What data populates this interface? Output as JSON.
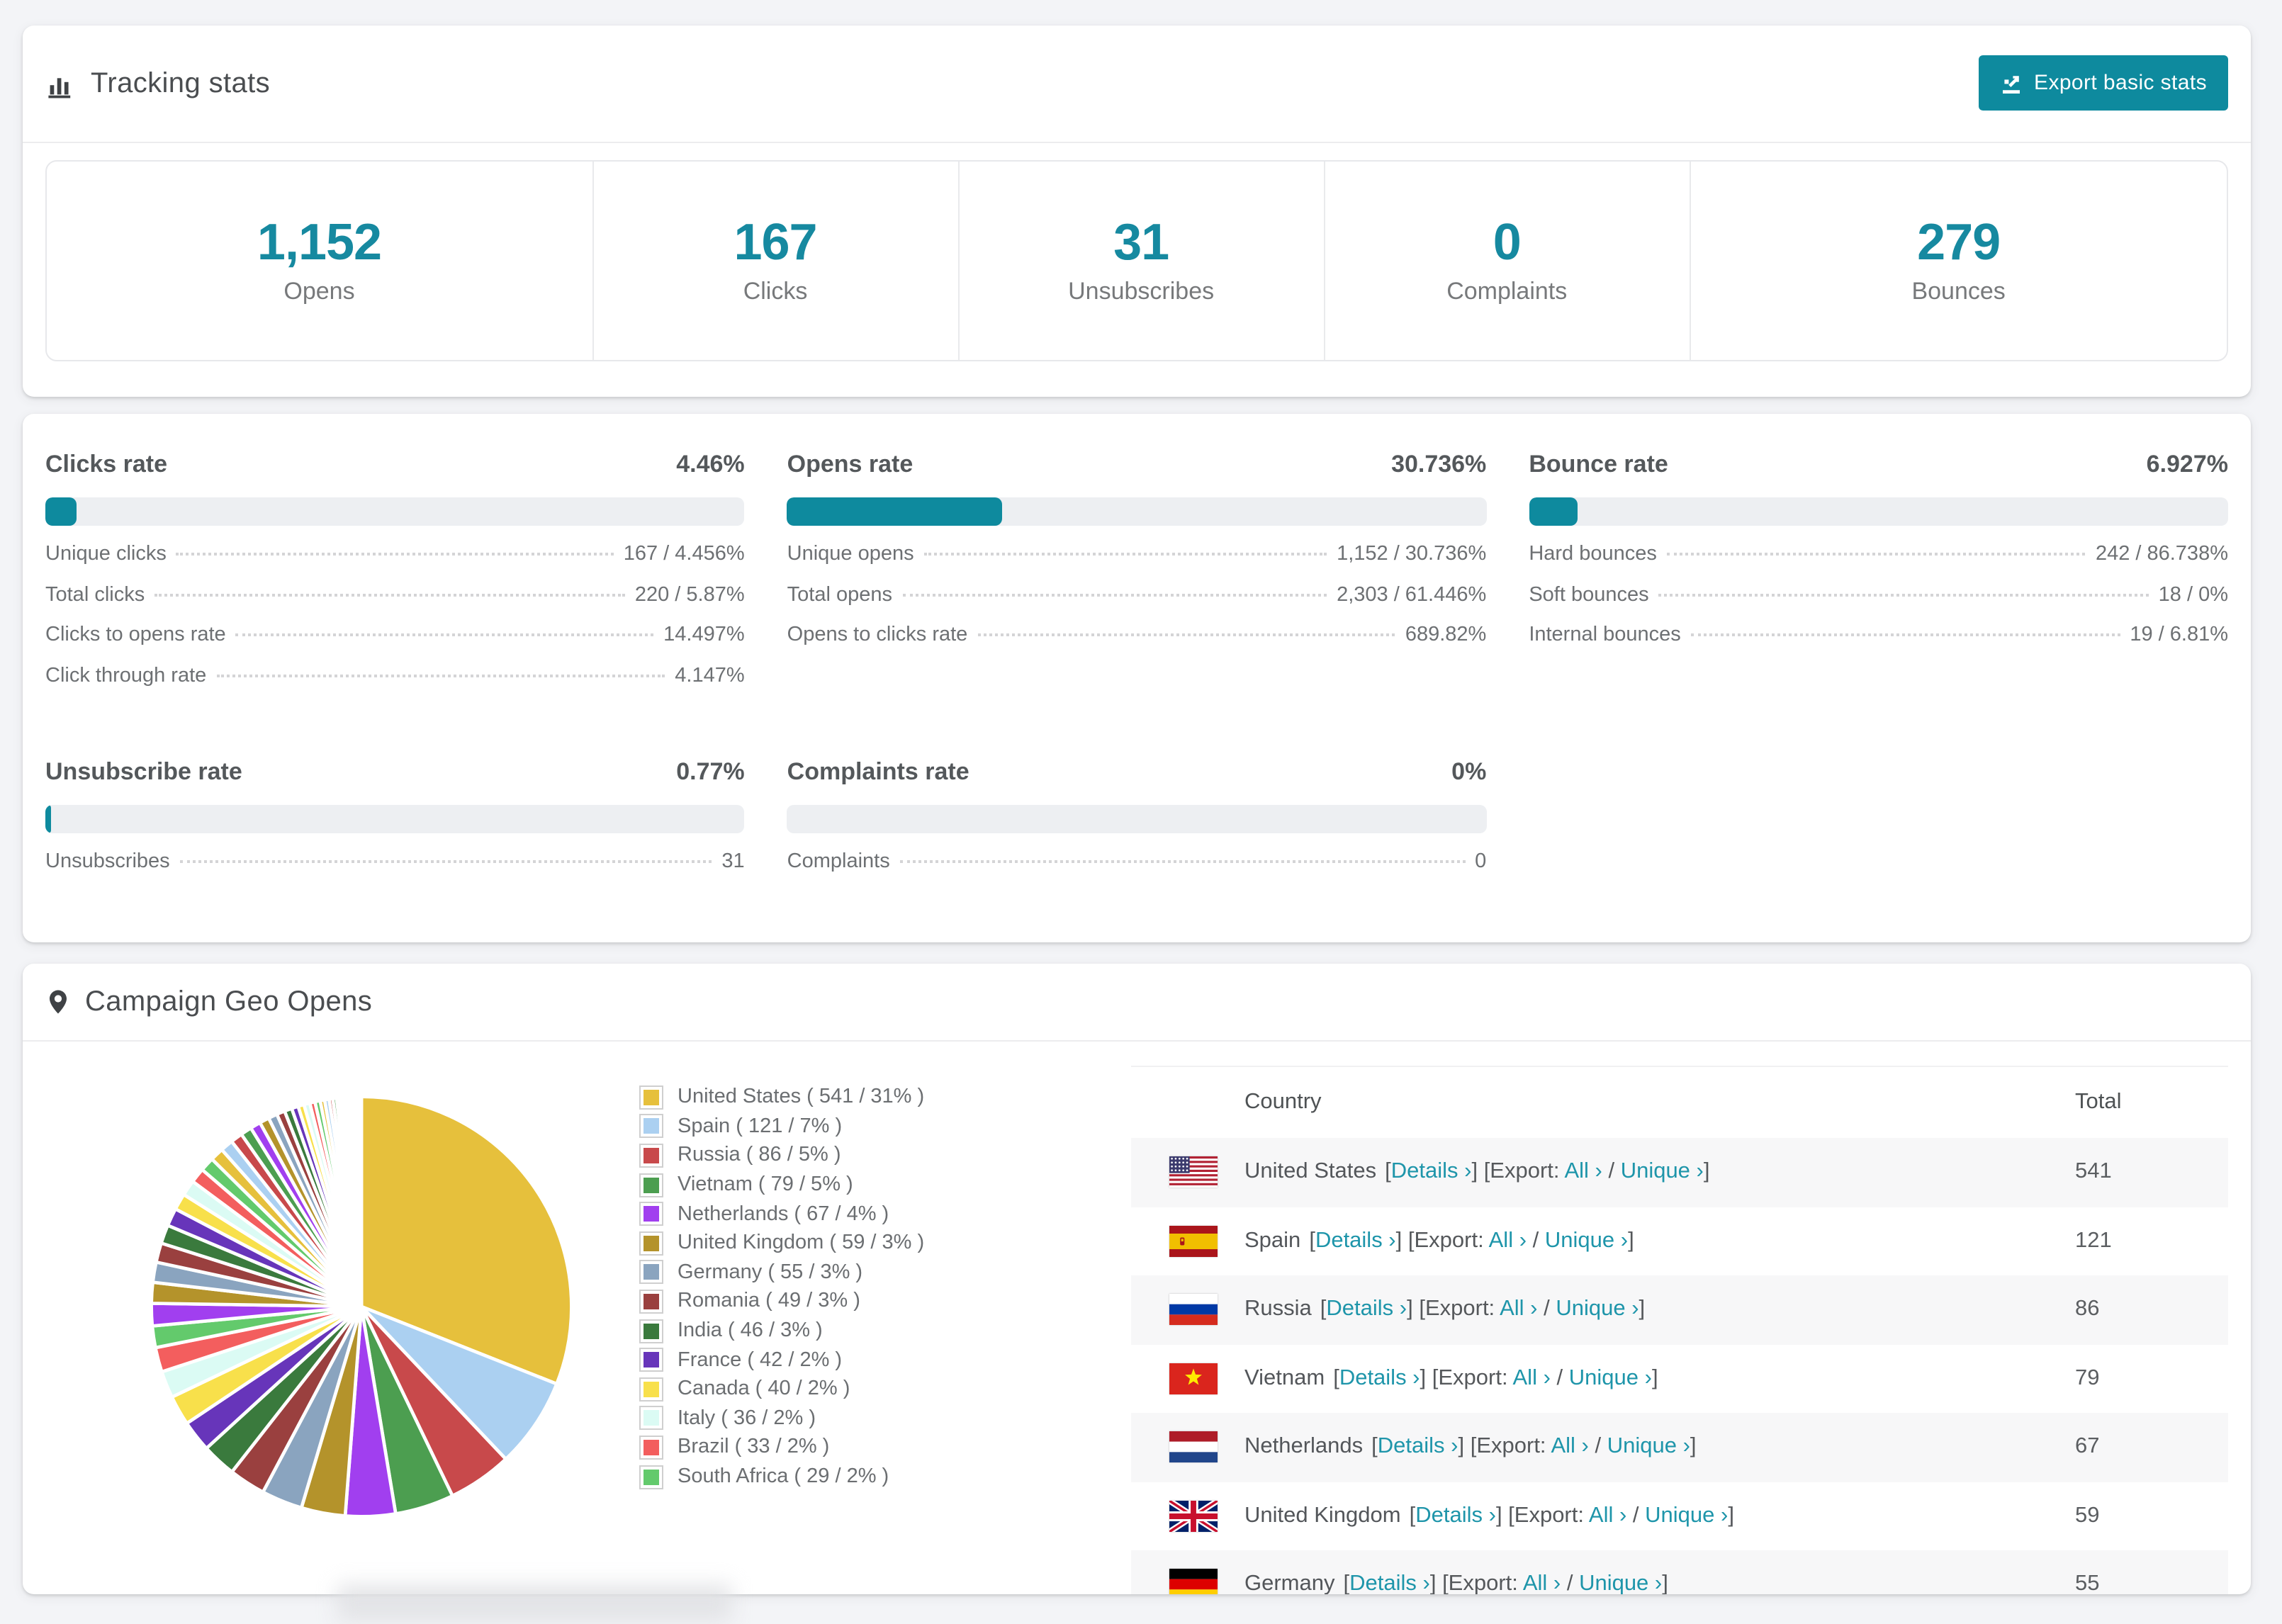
{
  "accent": "#0E8A9E",
  "link_color": "#1E95AA",
  "tracking": {
    "title": "Tracking stats",
    "export_button": "Export basic stats",
    "stats": [
      {
        "value": "1,152",
        "label": "Opens"
      },
      {
        "value": "167",
        "label": "Clicks"
      },
      {
        "value": "31",
        "label": "Unsubscribes"
      },
      {
        "value": "0",
        "label": "Complaints"
      },
      {
        "value": "279",
        "label": "Bounces"
      }
    ]
  },
  "rates": {
    "sections": [
      {
        "title": "Clicks rate",
        "value": "4.46%",
        "percent": 4.46,
        "rows": [
          {
            "label": "Unique clicks",
            "value": "167 / 4.456%"
          },
          {
            "label": "Total clicks",
            "value": "220 / 5.87%"
          },
          {
            "label": "Clicks to opens rate",
            "value": "14.497%"
          },
          {
            "label": "Click through rate",
            "value": "4.147%"
          }
        ]
      },
      {
        "title": "Opens rate",
        "value": "30.736%",
        "percent": 30.736,
        "rows": [
          {
            "label": "Unique opens",
            "value": "1,152 / 30.736%"
          },
          {
            "label": "Total opens",
            "value": "2,303 / 61.446%"
          },
          {
            "label": "Opens to clicks rate",
            "value": "689.82%"
          }
        ]
      },
      {
        "title": "Bounce rate",
        "value": "6.927%",
        "percent": 6.927,
        "rows": [
          {
            "label": "Hard bounces",
            "value": "242 / 86.738%"
          },
          {
            "label": "Soft bounces",
            "value": "18 / 0%"
          },
          {
            "label": "Internal bounces",
            "value": "19 / 6.81%"
          }
        ]
      },
      {
        "title": "Unsubscribe rate",
        "value": "0.77%",
        "percent": 0.77,
        "rows": [
          {
            "label": "Unsubscribes",
            "value": "31"
          }
        ]
      },
      {
        "title": "Complaints rate",
        "value": "0%",
        "percent": 0,
        "rows": [
          {
            "label": "Complaints",
            "value": "0"
          }
        ]
      }
    ]
  },
  "geo": {
    "title": "Campaign Geo Opens",
    "tokens": {
      "lb": "[",
      "rb": "]",
      "slash": " / ",
      "details": "Details ›",
      "export": "Export:",
      "all": "All ›",
      "unique": "Unique ›",
      "p_open": " ( ",
      "p_mid": " / ",
      "p_close": "% )"
    },
    "table": {
      "headers": [
        "Country",
        "Total"
      ],
      "rows": [
        {
          "country": "United States",
          "flag": "us",
          "total": "541"
        },
        {
          "country": "Spain",
          "flag": "es",
          "total": "121"
        },
        {
          "country": "Russia",
          "flag": "ru",
          "total": "86"
        },
        {
          "country": "Vietnam",
          "flag": "vn",
          "total": "79"
        },
        {
          "country": "Netherlands",
          "flag": "nl",
          "total": "67"
        },
        {
          "country": "United Kingdom",
          "flag": "gb",
          "total": "59"
        },
        {
          "country": "Germany",
          "flag": "de",
          "total": "55"
        }
      ]
    }
  },
  "chart_data": {
    "type": "pie",
    "title": "Campaign Geo Opens",
    "legend_position": "right",
    "start_angle_deg": -90,
    "direction": "clockwise",
    "slices": [
      {
        "label": "United States",
        "value": 541,
        "pct": 31,
        "color": "#E6C03C"
      },
      {
        "label": "Spain",
        "value": 121,
        "pct": 7,
        "color": "#ABD0F1"
      },
      {
        "label": "Russia",
        "value": 86,
        "pct": 5,
        "color": "#C8494B"
      },
      {
        "label": "Vietnam",
        "value": 79,
        "pct": 5,
        "color": "#4C9E50"
      },
      {
        "label": "Netherlands",
        "value": 67,
        "pct": 4,
        "color": "#A13FEF"
      },
      {
        "label": "United Kingdom",
        "value": 59,
        "pct": 3,
        "color": "#B4932B"
      },
      {
        "label": "Germany",
        "value": 55,
        "pct": 3,
        "color": "#8AA4BF"
      },
      {
        "label": "Romania",
        "value": 49,
        "pct": 3,
        "color": "#9A403F"
      },
      {
        "label": "India",
        "value": 46,
        "pct": 3,
        "color": "#3A7A3D"
      },
      {
        "label": "France",
        "value": 42,
        "pct": 2,
        "color": "#6735BA"
      },
      {
        "label": "Canada",
        "value": 40,
        "pct": 2,
        "color": "#F8E04B"
      },
      {
        "label": "Italy",
        "value": 36,
        "pct": 2,
        "color": "#DBFBF4"
      },
      {
        "label": "Brazil",
        "value": 33,
        "pct": 2,
        "color": "#F35E5E"
      },
      {
        "label": "South Africa",
        "value": 29,
        "pct": 2,
        "color": "#63CA6C"
      }
    ],
    "others_values": [
      30,
      28,
      27,
      26,
      25,
      24,
      22,
      21,
      20,
      19,
      18,
      17,
      16,
      15,
      14,
      13,
      12,
      11,
      10,
      9,
      8,
      8,
      7,
      7,
      6,
      6,
      5,
      5,
      4,
      4,
      3,
      3,
      3,
      2,
      2,
      2,
      2,
      1,
      1,
      1,
      1,
      1,
      1,
      1,
      1
    ],
    "others_palette_start": 4
  }
}
